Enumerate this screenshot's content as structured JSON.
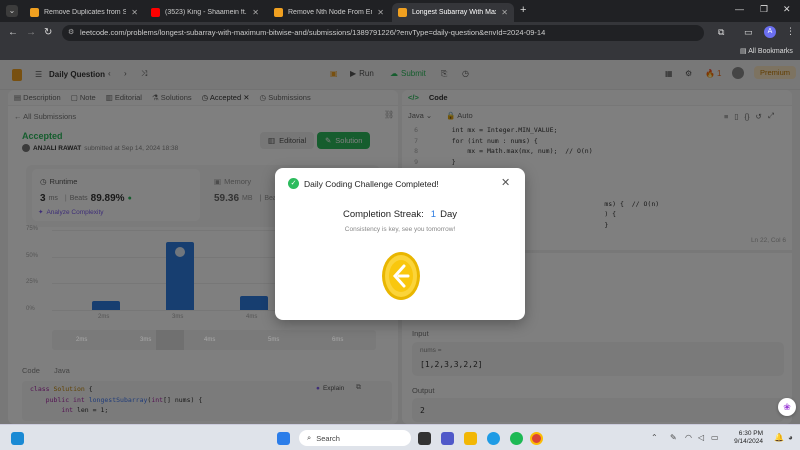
{
  "browser": {
    "tabs": [
      {
        "title": "Remove Duplicates from Sorte...",
        "favicon_color": "#f0a020"
      },
      {
        "title": "(3523) King - Shaamein ft. |",
        "favicon_color": "#ff0000"
      },
      {
        "title": "Remove Nth Node From End of...",
        "favicon_color": "#f0a020"
      },
      {
        "title": "Longest Subarray With Maxim...",
        "favicon_color": "#f0a020"
      }
    ],
    "url": "leetcode.com/problems/longest-subarray-with-maximum-bitwise-and/submissions/1389791226/?envType=daily-question&envId=2024-09-14",
    "bookmarks_label": "All Bookmarks",
    "profile_initial": "A"
  },
  "header": {
    "daily_question": "Daily Question",
    "run": "Run",
    "submit": "Submit",
    "streak_count": "1",
    "premium": "Premium"
  },
  "left": {
    "tabs": [
      "Description",
      "Note",
      "Editorial",
      "Solutions",
      "Accepted",
      "Submissions"
    ],
    "all_submissions": "All Submissions",
    "status": "Accepted",
    "author": "ANJALI RAWAT",
    "submitted": "submitted at Sep 14, 2024 18:38",
    "editorial_btn": "Editorial",
    "solution_btn": "Solution",
    "runtime_label": "Runtime",
    "runtime_value": "3",
    "runtime_unit": "ms",
    "beats_label": "Beats",
    "runtime_beats": "89.89%",
    "analyze": "Analyze Complexity",
    "memory_label": "Memory",
    "memory_value": "59.36",
    "memory_unit": "MB",
    "memory_beats_label": "Beats",
    "chart_ylabels": [
      "75%",
      "50%",
      "25%",
      "0%"
    ],
    "chart_xlabels": [
      "2ms",
      "3ms",
      "4ms",
      "5ms"
    ],
    "hist_labels": [
      "2ms",
      "3ms",
      "4ms",
      "5ms",
      "6ms"
    ],
    "code_tabs": [
      "Code",
      "Java"
    ],
    "code": [
      "class Solution {",
      "    public int longestSubarray(int[] nums) {",
      "        int len = 1;"
    ],
    "explain": "Explain"
  },
  "right": {
    "title": "Code",
    "lang": "Java",
    "auto": "Auto",
    "line_numbers": [
      "6",
      "7",
      "8",
      "9",
      "10",
      "11",
      "12",
      "13",
      "14",
      "15"
    ],
    "code_lines": [
      "int mx = Integer.MIN_VALUE;",
      "for (int num : nums) {",
      "    mx = Math.max(mx, num);  // O(n)",
      "}",
      "",
      "",
      "",
      "ms) {  // O(n)",
      ") {",
      "}"
    ],
    "cursor_pos": "Ln 22, Col 6",
    "input_label": "Input",
    "input_var": "nums =",
    "input_value": "[1,2,3,3,2,2]",
    "output_label": "Output",
    "output_value": "2"
  },
  "modal": {
    "title": "Daily Coding Challenge Completed!",
    "streak_label": "Completion Streak:",
    "streak_value": "1",
    "streak_unit": "Day",
    "message": "Consistency is key, see you tomorrow!"
  },
  "taskbar": {
    "search": "Search",
    "time": "6:30 PM",
    "date": "9/14/2024"
  },
  "chart_data": {
    "type": "bar",
    "categories": [
      "2ms",
      "3ms",
      "4ms",
      "5ms"
    ],
    "values": [
      8,
      64,
      13,
      2
    ],
    "ylim": [
      0,
      75
    ]
  }
}
